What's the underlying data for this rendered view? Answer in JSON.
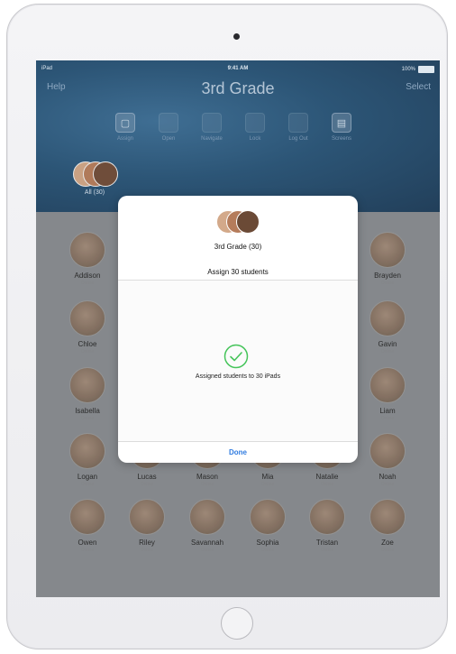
{
  "status_bar": {
    "carrier": "iPad",
    "time": "9:41 AM",
    "battery": "100%"
  },
  "nav": {
    "left_button": "Help",
    "title": "3rd Grade",
    "right_button": "Select"
  },
  "toolbar": [
    {
      "label": "Assign",
      "icon": "assign-icon"
    },
    {
      "label": "Open",
      "icon": "open-icon"
    },
    {
      "label": "Navigate",
      "icon": "navigate-icon"
    },
    {
      "label": "Lock",
      "icon": "lock-icon"
    },
    {
      "label": "Log Out",
      "icon": "log-out-icon"
    },
    {
      "label": "Screens",
      "icon": "screens-icon"
    }
  ],
  "group_filter": {
    "label": "All (30)"
  },
  "students": [
    {
      "name": "Addison",
      "status": "Online"
    },
    {
      "name": "Brayden",
      "status": "Online"
    },
    {
      "name": "Chloe",
      "status": "Online"
    },
    {
      "name": "Gavin",
      "status": "Online"
    },
    {
      "name": "Isabella",
      "status": "Online"
    },
    {
      "name": "Liam",
      "status": "Online"
    },
    {
      "name": "Logan",
      "status": "Online"
    },
    {
      "name": "Lucas",
      "status": "Online"
    },
    {
      "name": "Mason",
      "status": "Online"
    },
    {
      "name": "Mia",
      "status": "Online"
    },
    {
      "name": "Natalie",
      "status": "Online"
    },
    {
      "name": "Noah",
      "status": "Online"
    },
    {
      "name": "Owen",
      "status": "Online"
    },
    {
      "name": "Riley",
      "status": "Online"
    },
    {
      "name": "Savannah",
      "status": "Online"
    },
    {
      "name": "Sophia",
      "status": "Online"
    },
    {
      "name": "Tristan",
      "status": "Online"
    },
    {
      "name": "Zoe",
      "status": "Online"
    }
  ],
  "dialog": {
    "group_name": "3rd Grade (30)",
    "assign_title": "Assign 30 students",
    "message": "Assigned students to 30 iPads",
    "done_label": "Done"
  },
  "colors": {
    "accent": "#2f7be0",
    "check": "#45c45a",
    "header": "#2c5576"
  }
}
